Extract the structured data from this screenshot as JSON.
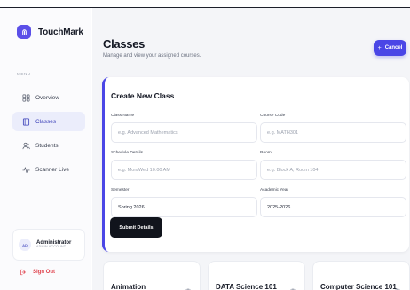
{
  "brand": {
    "name": "TouchMark"
  },
  "sidebar": {
    "menu_label": "MENU",
    "items": [
      {
        "label": "Overview",
        "icon": "grid-icon",
        "active": false
      },
      {
        "label": "Classes",
        "icon": "book-icon",
        "active": true
      },
      {
        "label": "Students",
        "icon": "users-icon",
        "active": false
      },
      {
        "label": "Scanner Live",
        "icon": "pulse-icon",
        "active": false
      }
    ],
    "user": {
      "initials": "AD",
      "name": "Administrator",
      "role": "ADMIN ACCOUNT"
    },
    "sign_out": "Sign Out"
  },
  "header": {
    "title": "Classes",
    "subtitle": "Manage and view your assigned courses.",
    "cancel_label": "Cancel",
    "cancel_icon": "+"
  },
  "form": {
    "title": "Create New Class",
    "fields": [
      {
        "label": "Class Name",
        "placeholder": "e.g. Advanced Mathematics",
        "value": ""
      },
      {
        "label": "Course Code",
        "placeholder": "e.g. MATH301",
        "value": ""
      },
      {
        "label": "Schedule Details",
        "placeholder": "e.g. Mon/Wed 10:00 AM",
        "value": ""
      },
      {
        "label": "Room",
        "placeholder": "e.g. Block A, Room 104",
        "value": ""
      },
      {
        "label": "Semester",
        "placeholder": "",
        "value": "Spring 2026"
      },
      {
        "label": "Academic Year",
        "placeholder": "",
        "value": "2025-2026"
      }
    ],
    "submit_label": "Submit Details"
  },
  "classes": [
    {
      "name": "Animation"
    },
    {
      "name": "DATA Science 101"
    },
    {
      "name": "Computer Science 101"
    }
  ],
  "colors": {
    "accent": "#4a46e6",
    "brand": "#5b4fe8",
    "danger": "#e0434e",
    "active_bg": "#ebedfb",
    "submit": "#11141c"
  }
}
